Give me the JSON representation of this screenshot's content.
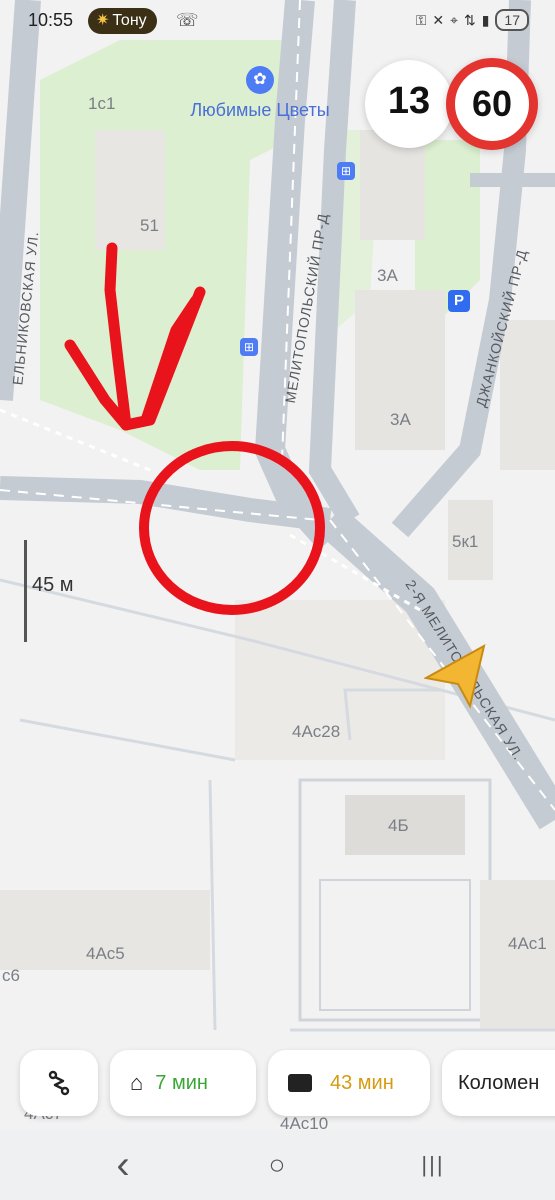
{
  "status": {
    "time": "10:55",
    "pill_label": "Тону",
    "battery": "17"
  },
  "map": {
    "poi_name": "Любимые Цветы",
    "labels": {
      "l1c1": "1с1",
      "l51": "51",
      "l3a_top": "3А",
      "l3a_bottom": "3А",
      "l5k1": "5к1",
      "l4ac28": "4Ас28",
      "l4b": "4Б",
      "l4ac5": "4Ас5",
      "l4ac1": "4Ас1",
      "lc6": "с6",
      "l4ac10": "4Ас10",
      "l4ac7": "4Ас7"
    },
    "streets": {
      "melnikovskaya": "ЕЛЬНИКОВСКАЯ УЛ.",
      "melitopolsky": "МЕЛИТОПОЛЬСКИЙ ПР-Д",
      "dzhankoysky": "ДЖАНКОЙСКИЙ ПР-Д",
      "melitopolskaya_2": "2-Я МЕЛИТОПОЛЬСКАЯ УЛ."
    },
    "parking": "P",
    "colors": {
      "park": "#dcefd0",
      "road": "#c5cbd3",
      "annotation": "#e8131b",
      "cursor": "#f2b632"
    }
  },
  "speed": {
    "current": "13",
    "limit": "60"
  },
  "scale": {
    "label": "45 м"
  },
  "bottom": {
    "route_icon": "route-icon",
    "home_time": "7 мин",
    "work_time": "43 мин",
    "destination": "Коломен"
  },
  "navbar": {
    "back": "‹",
    "home": "○",
    "recents": "|||"
  }
}
